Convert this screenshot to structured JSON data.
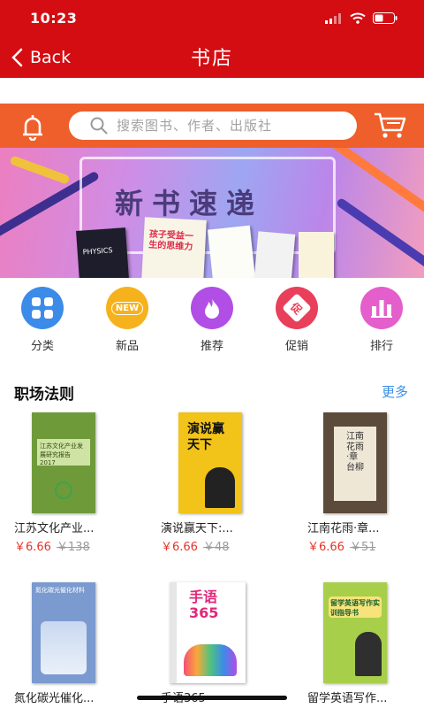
{
  "status_bar": {
    "time": "10:23"
  },
  "nav": {
    "back_label": "Back",
    "title": "书店"
  },
  "search": {
    "placeholder": "搜索图书、作者、出版社"
  },
  "banner": {
    "title": "新书速递",
    "book_texts": [
      "PHYSICS",
      "孩子受益一生的思维力"
    ]
  },
  "categories": [
    {
      "label": "分类",
      "icon": "grid-icon",
      "color": "#3d8be8"
    },
    {
      "label": "新品",
      "icon": "new-badge-icon",
      "color": "#f5b21c",
      "badge": "NEW"
    },
    {
      "label": "推荐",
      "icon": "flame-icon",
      "color": "#b14ee6"
    },
    {
      "label": "促销",
      "icon": "promo-icon",
      "color": "#e8405a",
      "badge": "促"
    },
    {
      "label": "排行",
      "icon": "chart-icon",
      "color": "#e45fcb"
    }
  ],
  "section": {
    "title": "职场法则",
    "more_label": "更多"
  },
  "books": [
    {
      "name": "江苏文化产业...",
      "price": "￥6.66",
      "old_price": "￥138",
      "cover_text": "江苏文化产业发展研究报告 2017"
    },
    {
      "name": "演说赢天下:...",
      "price": "￥6.66",
      "old_price": "￥48",
      "cover_text": "演说赢天下"
    },
    {
      "name": "江南花雨·章...",
      "price": "￥6.66",
      "old_price": "￥51",
      "cover_text": "江南花雨·章台柳"
    },
    {
      "name": "氮化碳光催化...",
      "cover_text": "氮化碳光催化材料"
    },
    {
      "name": "手语365",
      "cover_text": "手语 365"
    },
    {
      "name": "留学英语写作...",
      "cover_text": "留学英语写作实训指导书"
    }
  ],
  "colors": {
    "nav_red": "#d40d12",
    "search_orange": "#ee5f2b",
    "price_red": "#e4332a",
    "link_blue": "#3a8ee6"
  }
}
